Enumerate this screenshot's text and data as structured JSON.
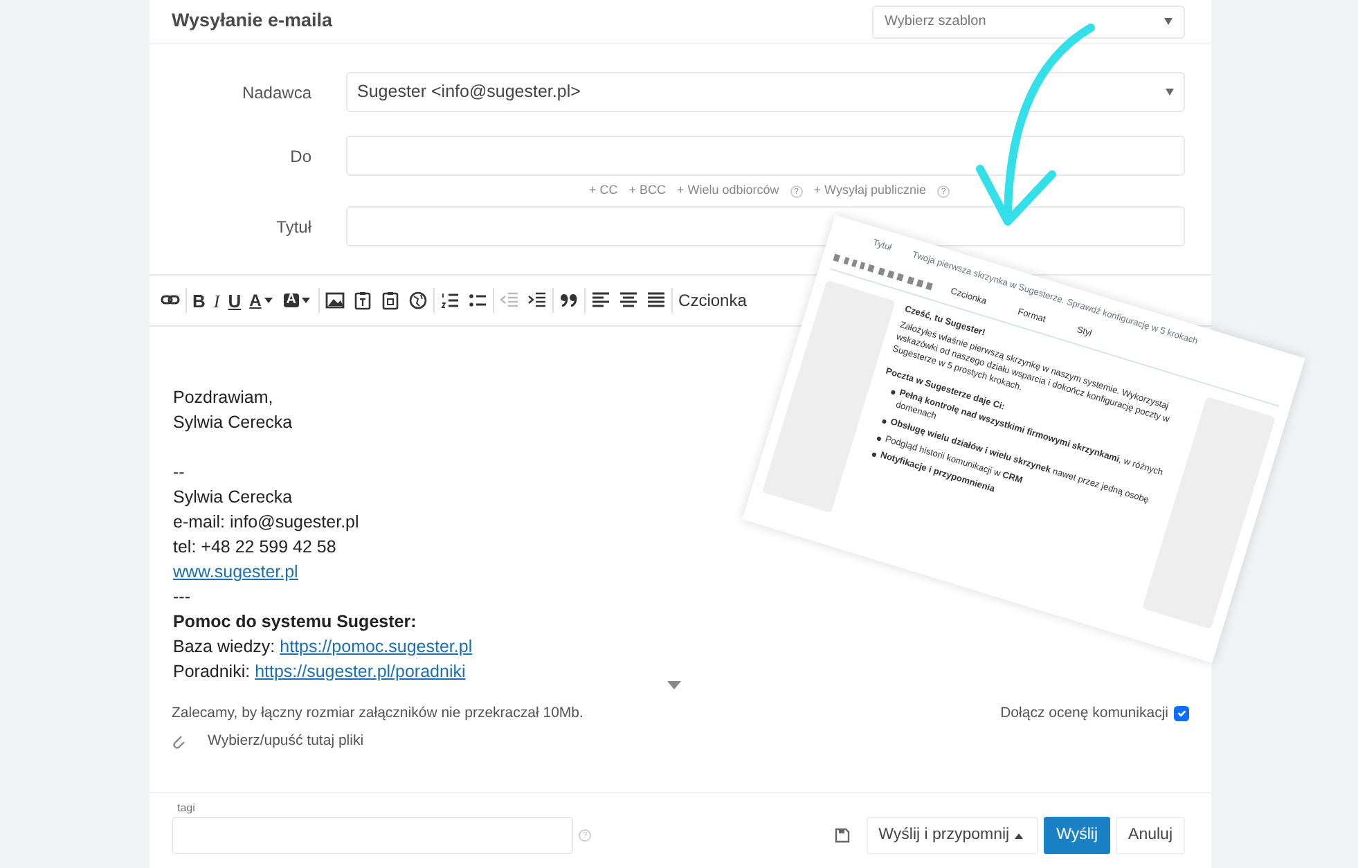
{
  "header": {
    "title": "Wysyłanie e-maila",
    "template_select": {
      "placeholder": "Wybierz szablon"
    }
  },
  "form": {
    "sender": {
      "label": "Nadawca",
      "value": "Sugester <info@sugester.pl>"
    },
    "to": {
      "label": "Do"
    },
    "extra_links": [
      {
        "label": "+ CC"
      },
      {
        "label": "+ BCC"
      },
      {
        "label": "+ Wielu odbiorców",
        "help": "?"
      },
      {
        "label": "+ Wysyłaj publicznie",
        "help": "?"
      }
    ],
    "subject": {
      "label": "Tytuł"
    }
  },
  "toolbar": [
    {
      "kind": "link"
    },
    {
      "kind": "sep"
    },
    {
      "kind": "char",
      "label": "B"
    },
    {
      "kind": "char-italic",
      "label": "I"
    },
    {
      "kind": "char-underline",
      "label": "U"
    },
    {
      "kind": "text-color",
      "label": "A"
    },
    {
      "kind": "bg-color",
      "label": "A"
    },
    {
      "kind": "sep"
    },
    {
      "kind": "image"
    },
    {
      "kind": "paste-text"
    },
    {
      "kind": "paste-word"
    },
    {
      "kind": "globe"
    },
    {
      "kind": "sep"
    },
    {
      "kind": "ordered-list"
    },
    {
      "kind": "bullet-list"
    },
    {
      "kind": "sep"
    },
    {
      "kind": "outdent"
    },
    {
      "kind": "indent"
    },
    {
      "kind": "sep"
    },
    {
      "kind": "quote"
    },
    {
      "kind": "sep"
    },
    {
      "kind": "align-left"
    },
    {
      "kind": "align-center"
    },
    {
      "kind": "justify"
    },
    {
      "kind": "sep"
    },
    {
      "kind": "dropdown",
      "label": "Czcionka"
    }
  ],
  "body": [
    {
      "kind": "text",
      "text": "Pozdrawiam,"
    },
    {
      "kind": "text",
      "text": "Sylwia Cerecka"
    },
    {
      "kind": "blank"
    },
    {
      "kind": "text",
      "text": "--"
    },
    {
      "kind": "text",
      "text": "Sylwia Cerecka"
    },
    {
      "kind": "text",
      "text": "e-mail: info@sugester.pl"
    },
    {
      "kind": "text",
      "text": "tel: +48 22 599 42 58"
    },
    {
      "kind": "link",
      "link": "www.sugester.pl"
    },
    {
      "kind": "text",
      "text": "---"
    },
    {
      "kind": "bold",
      "text": "Pomoc do systemu Sugester:"
    },
    {
      "kind": "labeled-link",
      "text": "Baza wiedzy:",
      "link": "https://pomoc.sugester.pl"
    },
    {
      "kind": "labeled-link",
      "text": "Poradniki:",
      "link": "https://sugester.pl/poradniki"
    }
  ],
  "attachments": {
    "note": "Zalecamy, by łączny rozmiar załączników nie przekraczał 10Mb.",
    "drop_label": "Wybierz/upuść tutaj pliki",
    "rating": {
      "label": "Dołącz ocenę komunikacji",
      "checked": true
    }
  },
  "tags": {
    "label": "tagi",
    "help": "?"
  },
  "buttons": [
    {
      "kind": "save-icon"
    },
    {
      "kind": "dropup",
      "label": "Wyślij i przypomnij"
    },
    {
      "kind": "primary",
      "label": "Wyślij"
    },
    {
      "kind": "default",
      "label": "Anuluj"
    }
  ],
  "preview": {
    "subject_label": "Tytuł",
    "subject": "Twoja pierwsza skrzynka w Sugesterze. Sprawdź konfigurację w 5 krokach",
    "toolbar_labels": [
      "Czcionka",
      "Format",
      "Styl"
    ],
    "greeting": "Cześć, tu Sugester!",
    "intro": "Założyłeś właśnie pierwszą skrzynkę w naszym systemie. Wykorzystaj wskazówki od naszego działu wsparcia i dokończ konfigurację poczty w Sugesterze w 5 prostych krokach.",
    "heading": "Poczta w Sugesterze daje Ci:",
    "bullets": [
      "**Pełną kontrolę nad wszystkimi firmowymi skrzynkami**, w różnych domenach",
      "**Obsługę wielu działów i wielu skrzynek** nawet przez jedną osobę",
      "Podgląd historii komunikacji w **CRM**",
      "**Notyfikacje i przypomnienia**"
    ]
  }
}
